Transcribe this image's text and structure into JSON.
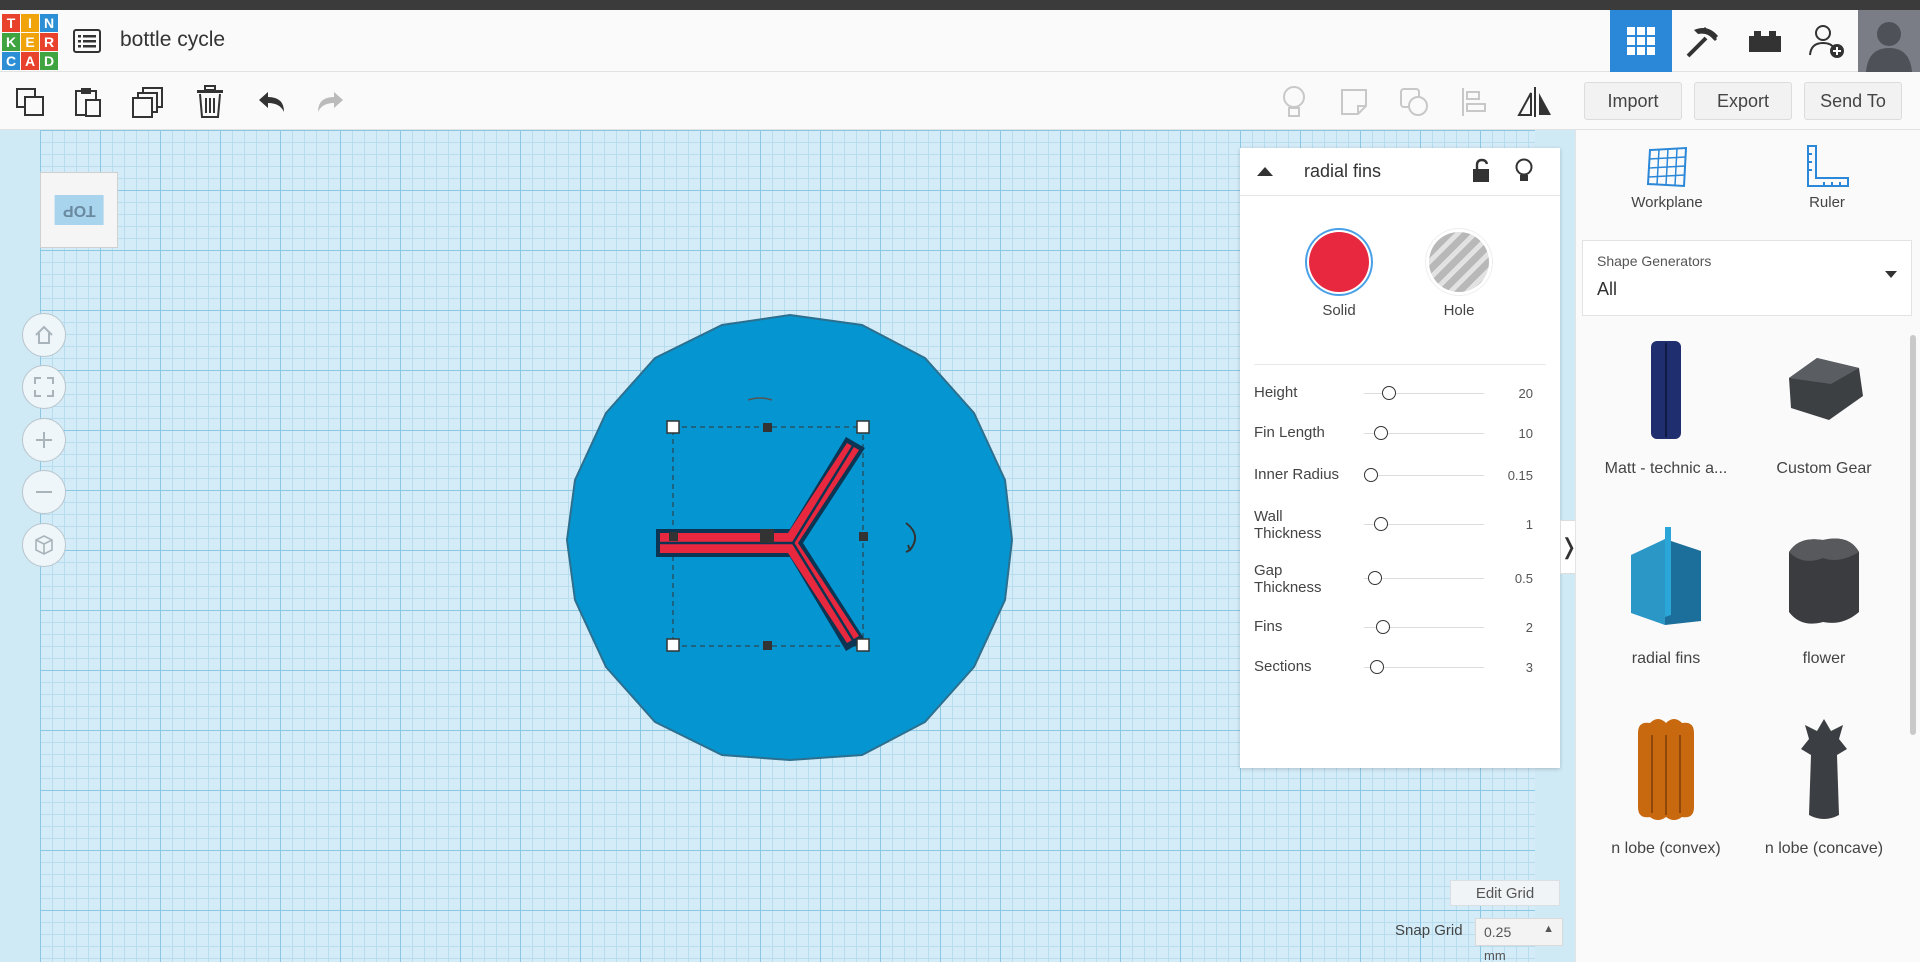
{
  "app": {
    "logo_letters": [
      "T",
      "I",
      "N",
      "K",
      "E",
      "R",
      "C",
      "A",
      "D"
    ],
    "logo_colors": [
      "#e8412c",
      "#f0a30a",
      "#2c8fd6",
      "#3fa33f",
      "#f0a30a",
      "#e8412c",
      "#2c8fd6",
      "#e8412c",
      "#3fa33f"
    ],
    "document_title": "bottle cycle"
  },
  "topnav": {
    "items": [
      "grid-view-icon",
      "build-pickaxe-icon",
      "bricks-icon",
      "add-user-icon",
      "user-avatar"
    ],
    "active_color": "#2b87d8"
  },
  "toolbar": {
    "left_icons": [
      "copy-icon",
      "paste-icon",
      "duplicate-icon",
      "delete-icon",
      "undo-icon",
      "redo-icon"
    ],
    "right_icons": [
      "light-bulb-icon",
      "note-icon",
      "group-icon",
      "align-icon",
      "mirror-icon"
    ],
    "import_label": "Import",
    "export_label": "Export",
    "send_to_label": "Send To"
  },
  "viewcube": {
    "face_label": "TOP"
  },
  "view_controls": [
    "home-view-icon",
    "fit-view-icon",
    "zoom-in-icon",
    "zoom-out-icon",
    "perspective-icon"
  ],
  "scene": {
    "base_color": "#0596d1",
    "selected_color": "#e8283e"
  },
  "inspector": {
    "shape_name": "radial fins",
    "solid_label": "Solid",
    "hole_label": "Hole",
    "solid_color": "#e8283e",
    "params": [
      {
        "label": "Height",
        "value": "20"
      },
      {
        "label": "Fin Length",
        "value": "10"
      },
      {
        "label": "Inner Radius",
        "value": "0.15"
      },
      {
        "label": "Wall Thickness",
        "value": "1"
      },
      {
        "label": "Gap Thickness",
        "value": "0.5"
      },
      {
        "label": "Fins",
        "value": "2"
      },
      {
        "label": "Sections",
        "value": "3"
      }
    ]
  },
  "grid_controls": {
    "edit_grid_label": "Edit Grid",
    "snap_grid_label": "Snap Grid",
    "snap_value": "0.25",
    "snap_unit": "mm"
  },
  "sidebar": {
    "workplane_label": "Workplane",
    "ruler_label": "Ruler",
    "generators_title": "Shape Generators",
    "generators_value": "All",
    "shapes": [
      {
        "label": "Matt - technic a...",
        "color": "#1f2e6e"
      },
      {
        "label": "Custom Gear",
        "color": "#3d4043"
      },
      {
        "label": "radial fins",
        "color": "#1b6f9a"
      },
      {
        "label": "flower",
        "color": "#3a3c3f"
      },
      {
        "label": "n lobe (convex)",
        "color": "#c8680f"
      },
      {
        "label": "n lobe (concave)",
        "color": "#3b3e42"
      }
    ]
  }
}
